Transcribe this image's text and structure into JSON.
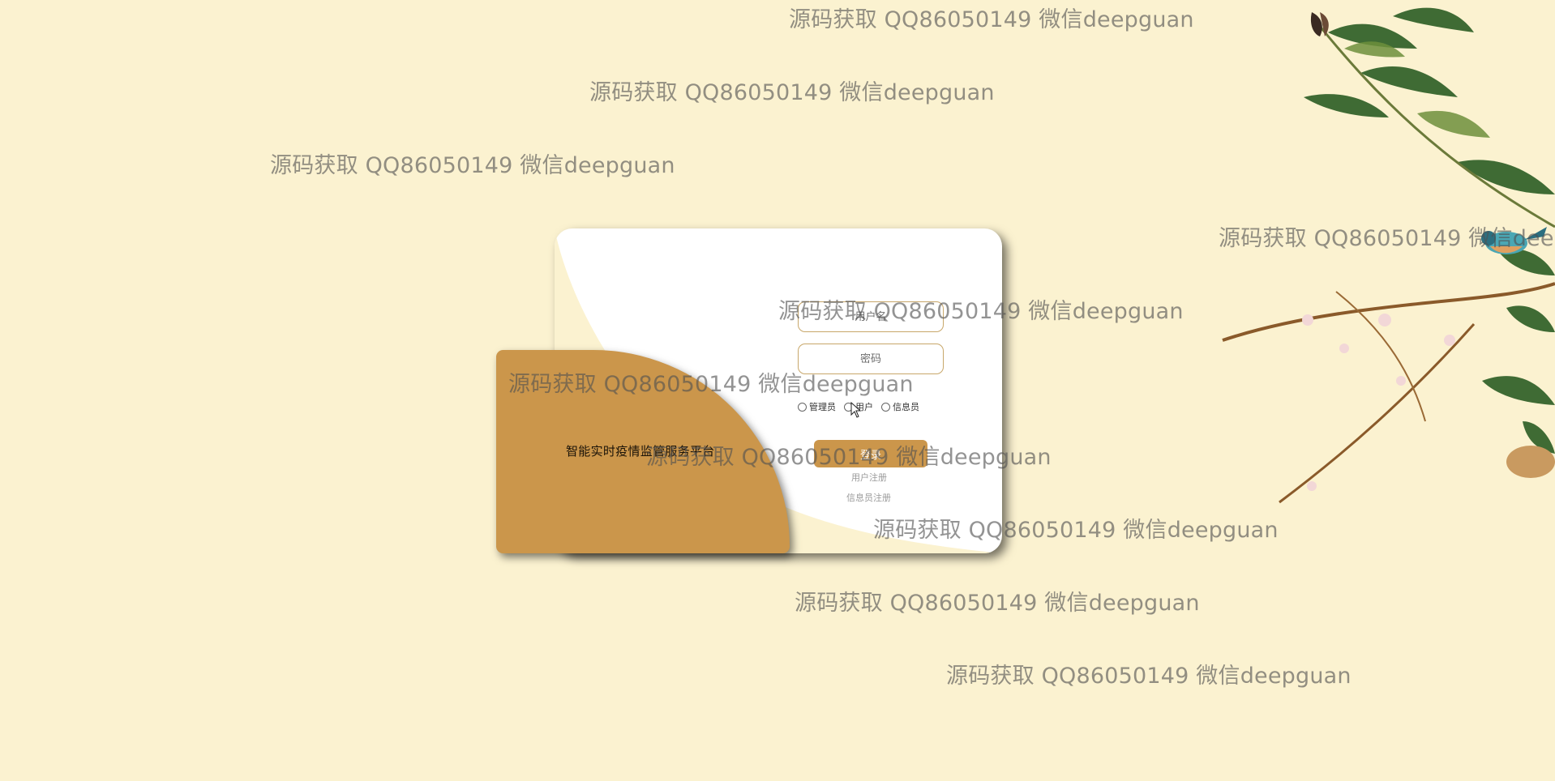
{
  "panel": {
    "title": "智能实时疫情监管服务平台"
  },
  "form": {
    "username_placeholder": "用户名",
    "password_placeholder": "密码",
    "roles": [
      "管理员",
      "用户",
      "信息员"
    ],
    "login_label": "登录",
    "register_user_label": "用户注册",
    "register_info_label": "信息员注册"
  },
  "watermark": "源码获取 QQ86050149 微信deepguan",
  "colors": {
    "background": "#fbf2d0",
    "accent": "#cb964b",
    "card": "#ffffff"
  }
}
